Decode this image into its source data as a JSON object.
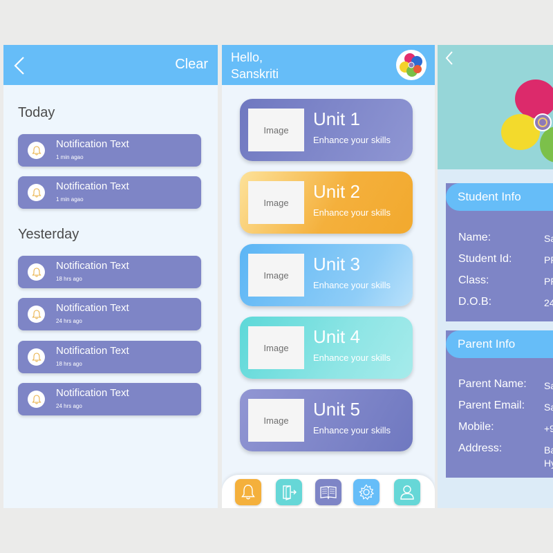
{
  "colors": {
    "header_blue": "#66bdf8",
    "card_purple": "#7e85c6",
    "unit_orange": "#f4b03c",
    "unit_blue": "#6fbff6",
    "unit_teal": "#6fdede",
    "profile_teal": "#96d6d8"
  },
  "notifications_screen": {
    "back_icon": "chevron-left-icon",
    "clear_label": "Clear",
    "today_label": "Today",
    "yesterday_label": "Yesterday",
    "today_items": [
      {
        "text": "Notification Text",
        "time": "1 min agao"
      },
      {
        "text": "Notification Text",
        "time": "1 min agao"
      }
    ],
    "yesterday_items": [
      {
        "text": "Notification Text",
        "time": "18 hrs ago"
      },
      {
        "text": "Notification Text",
        "time": "24 hrs ago"
      },
      {
        "text": "Notification Text",
        "time": "18 hrs ago"
      },
      {
        "text": "Notification Text",
        "time": "24 hrs ago"
      }
    ]
  },
  "units_screen": {
    "greeting_line1": "Hello,",
    "greeting_line2": "Sanskriti",
    "units": [
      {
        "title": "Unit 1",
        "subtitle": "Enhance your skills",
        "image_label": "Image"
      },
      {
        "title": "Unit 2",
        "subtitle": "Enhance your skills",
        "image_label": "Image"
      },
      {
        "title": "Unit 3",
        "subtitle": "Enhance your skills",
        "image_label": "Image"
      },
      {
        "title": "Unit 4",
        "subtitle": "Enhance your skills",
        "image_label": "Image"
      },
      {
        "title": "Unit 5",
        "subtitle": "Enhance your skills",
        "image_label": "Image"
      }
    ],
    "nav_icons": [
      "bell-icon",
      "exit-icon",
      "book-icon",
      "gear-icon",
      "user-icon"
    ]
  },
  "profile_screen": {
    "back_icon": "chevron-left-icon",
    "student_info": {
      "title": "Student Info",
      "fields": [
        {
          "label": "Name:",
          "value": "Sa"
        },
        {
          "label": "Student Id:",
          "value": "PR"
        },
        {
          "label": "Class:",
          "value": "PR"
        },
        {
          "label": "D.O.B:",
          "value": "24"
        }
      ]
    },
    "parent_info": {
      "title": "Parent Info",
      "fields": [
        {
          "label": "Parent Name:",
          "value": "Sa"
        },
        {
          "label": "Parent Email:",
          "value": "Sa"
        },
        {
          "label": "Mobile:",
          "value": "+9"
        },
        {
          "label": "Address:",
          "value": "Ba",
          "value2": "Hy"
        }
      ]
    }
  }
}
